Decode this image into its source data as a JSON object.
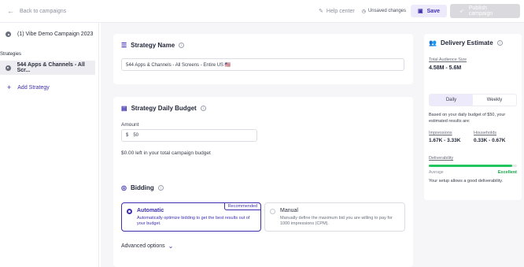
{
  "topbar": {
    "back_label": "Back to campaigns",
    "help_label": "Help center",
    "unsaved_label": "Unsaved changes",
    "save_label": "Save",
    "publish_label": "Publish campaign"
  },
  "sidebar": {
    "campaign_name": "(1) Vibe Demo Campaign 2023",
    "strategies_title": "Strategies",
    "strategies": [
      {
        "label": "544 Apps & Channels - All Scr..."
      }
    ],
    "add_strategy_label": "Add Strategy"
  },
  "strategy_name": {
    "title": "Strategy Name",
    "value": "544 Apps & Channels - All Screens - Entire US 🇺🇸"
  },
  "daily_budget": {
    "title": "Strategy Daily Budget",
    "amount_label": "Amount",
    "currency": "$",
    "amount_value": "50",
    "remaining_text": "$0.00 left in your total campaign budget"
  },
  "bidding": {
    "title": "Bidding",
    "automatic": {
      "title": "Automatic",
      "description": "Automatically optimize bidding to get the best results out of your budget.",
      "badge": "Recommended",
      "selected": true
    },
    "manual": {
      "title": "Manual",
      "description": "Manually define the maximum bid you are willing to pay for 1000 impressions (CPM).",
      "selected": false
    },
    "advanced_label": "Advanced options"
  },
  "delivery": {
    "title": "Delivery Estimate",
    "audience_label": "Total Audience Size",
    "audience_value": "4.58M - 5.6M",
    "tabs": [
      "Daily",
      "Weekly"
    ],
    "active_tab": "Daily",
    "note": "Based on your daily budget of $50, your estimated results are:",
    "impressions_label": "Impressions",
    "impressions_value": "1.67K - 3.33K",
    "households_label": "Households",
    "households_value": "0.33K - 0.67K",
    "deliverability_label": "Deliverability",
    "deliverability_fraction": 0.95,
    "scale_low": "Average",
    "scale_high": "Excellent",
    "deliverability_note": "Your setup allows a good deliverability."
  },
  "colors": {
    "accent": "#3d2fb0",
    "success": "#22c55e",
    "success_text": "#16a34a",
    "automatic_desc": "#3d2fb0",
    "manual_desc": "#6b6f7c"
  },
  "icons": [
    "arrow-left-icon",
    "edit-icon",
    "clock-icon",
    "save-icon",
    "rocket-icon",
    "bullet-icon",
    "plus-icon",
    "lines-icon",
    "budget-icon",
    "bidding-icon",
    "info-icon",
    "users-icon",
    "chevron-down-icon"
  ]
}
